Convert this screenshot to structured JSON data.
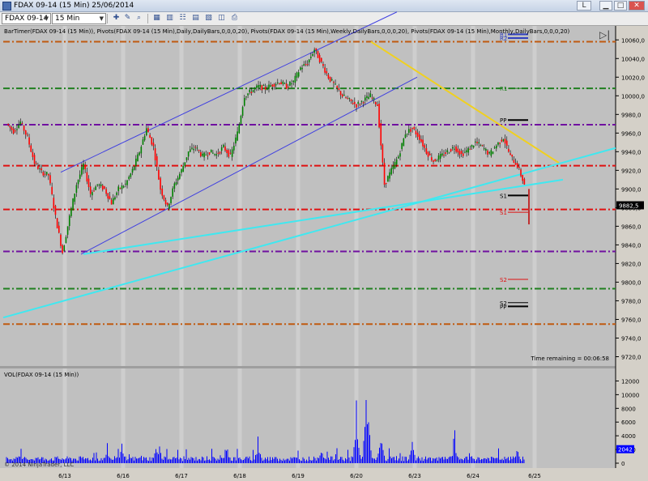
{
  "window": {
    "title": "FDAX 09-14 (15 Min)  25/06/2014",
    "btn_l": "L"
  },
  "toolbar": {
    "instrument": "FDAX 09-14",
    "interval": "15 Min"
  },
  "indicators_label": "BarTimer(FDAX 09-14 (15 Min)), Pivots(FDAX 09-14 (15 Min),Daily,DailyBars,0,0,0,20), Pivots(FDAX 09-14 (15 Min),Weekly,DailyBars,0,0,0,20), Pivots(FDAX 09-14 (15 Min),Monthly,DailyBars,0,0,0,20)",
  "volume_label": "VOL(FDAX 09-14 (15 Min))",
  "copyright": "© 2014 NinjaTrader, LLC",
  "time_remaining": "Time remaining = 00:06:58",
  "price_axis": {
    "ticks": [
      "10060,0",
      "10040,0",
      "10020,0",
      "10000,0",
      "9980,0",
      "9960,0",
      "9940,0",
      "9920,0",
      "9900,0",
      "9880,0",
      "9860,0",
      "9840,0",
      "9820,0",
      "9800,0",
      "9780,0",
      "9760,0",
      "9740,0",
      "9720,0"
    ]
  },
  "vol_axis": {
    "ticks": [
      "12000",
      "10000",
      "8000",
      "6000",
      "4000",
      "2000",
      "0"
    ]
  },
  "last_price": "9882,5",
  "last_volume": "2042",
  "pivot_labels": {
    "r1": "R1",
    "r2": "R2",
    "r1b": "R1",
    "pp": "PP",
    "s1a": "S1",
    "s1b": "S1",
    "s2": "S2",
    "s2b": "S2",
    "pp2": "PP"
  },
  "colors": {
    "plot_bg": "#c0c0c0",
    "up_bar": "#008000",
    "down_bar": "#ff0000",
    "channel": "#4040e0",
    "trend_yellow": "#f0d020",
    "trend_cyan": "#40e8f0",
    "volume": "#0000ff"
  },
  "chart_data": {
    "type": "candlestick",
    "x_ticks": [
      "6/13",
      "6/16",
      "6/17",
      "6/18",
      "6/19",
      "6/20",
      "6/23",
      "6/24",
      "6/25"
    ],
    "ylim": [
      9710,
      10075
    ],
    "price_path": [
      [
        0,
        9970
      ],
      [
        0.02,
        9962
      ],
      [
        0.04,
        9972
      ],
      [
        0.06,
        9955
      ],
      [
        0.08,
        9928
      ],
      [
        0.1,
        9918
      ],
      [
        0.12,
        9915
      ],
      [
        0.14,
        9870
      ],
      [
        0.16,
        9832
      ],
      [
        0.18,
        9870
      ],
      [
        0.2,
        9905
      ],
      [
        0.22,
        9926
      ],
      [
        0.24,
        9895
      ],
      [
        0.26,
        9905
      ],
      [
        0.28,
        9900
      ],
      [
        0.3,
        9885
      ],
      [
        0.32,
        9900
      ],
      [
        0.34,
        9905
      ],
      [
        0.36,
        9920
      ],
      [
        0.38,
        9940
      ],
      [
        0.4,
        9965
      ],
      [
        0.42,
        9945
      ],
      [
        0.44,
        9900
      ],
      [
        0.46,
        9880
      ],
      [
        0.48,
        9905
      ],
      [
        0.5,
        9920
      ],
      [
        0.52,
        9940
      ],
      [
        0.54,
        9945
      ],
      [
        0.56,
        9935
      ],
      [
        0.58,
        9940
      ],
      [
        0.6,
        9937
      ],
      [
        0.62,
        9945
      ],
      [
        0.64,
        9935
      ],
      [
        0.66,
        9960
      ],
      [
        0.68,
        10000
      ],
      [
        0.7,
        10005
      ],
      [
        0.72,
        10010
      ],
      [
        0.74,
        10008
      ],
      [
        0.76,
        10012
      ],
      [
        0.78,
        10015
      ],
      [
        0.8,
        10010
      ],
      [
        0.82,
        10015
      ],
      [
        0.84,
        10030
      ],
      [
        0.86,
        10035
      ],
      [
        0.88,
        10050
      ],
      [
        0.9,
        10035
      ],
      [
        0.92,
        10020
      ],
      [
        0.94,
        10010
      ],
      [
        0.96,
        10000
      ],
      [
        0.98,
        9995
      ],
      [
        1.0,
        9990
      ],
      [
        1.02,
        9995
      ],
      [
        1.04,
        10000
      ],
      [
        1.06,
        9990
      ],
      [
        1.08,
        9905
      ],
      [
        1.1,
        9920
      ],
      [
        1.12,
        9935
      ],
      [
        1.14,
        9960
      ],
      [
        1.16,
        9965
      ],
      [
        1.18,
        9955
      ],
      [
        1.2,
        9940
      ],
      [
        1.22,
        9930
      ],
      [
        1.24,
        9935
      ],
      [
        1.26,
        9940
      ],
      [
        1.28,
        9945
      ],
      [
        1.3,
        9937
      ],
      [
        1.32,
        9942
      ],
      [
        1.34,
        9950
      ],
      [
        1.36,
        9945
      ],
      [
        1.38,
        9937
      ],
      [
        1.4,
        9947
      ],
      [
        1.42,
        9955
      ],
      [
        1.44,
        9935
      ],
      [
        1.46,
        9925
      ],
      [
        1.48,
        9905
      ]
    ],
    "pivot_levels": [
      {
        "value": 10058,
        "color": "#c05a10"
      },
      {
        "value": 10008,
        "color": "#208020"
      },
      {
        "value": 9969,
        "color": "#7010a0"
      },
      {
        "value": 9925,
        "color": "#e01010"
      },
      {
        "value": 9878,
        "color": "#e01010"
      },
      {
        "value": 9833,
        "color": "#7010a0"
      },
      {
        "value": 9793,
        "color": "#208020"
      },
      {
        "value": 9755,
        "color": "#c05a10"
      }
    ],
    "volume_peaks": [
      [
        0.29,
        2200
      ],
      [
        0.33,
        2500
      ],
      [
        0.43,
        3000
      ],
      [
        0.63,
        2400
      ],
      [
        0.72,
        3200
      ],
      [
        0.9,
        2500
      ],
      [
        1.0,
        5200
      ],
      [
        1.03,
        11800
      ],
      [
        1.07,
        4500
      ],
      [
        1.16,
        2600
      ],
      [
        1.28,
        3200
      ],
      [
        1.46,
        2042
      ]
    ]
  }
}
